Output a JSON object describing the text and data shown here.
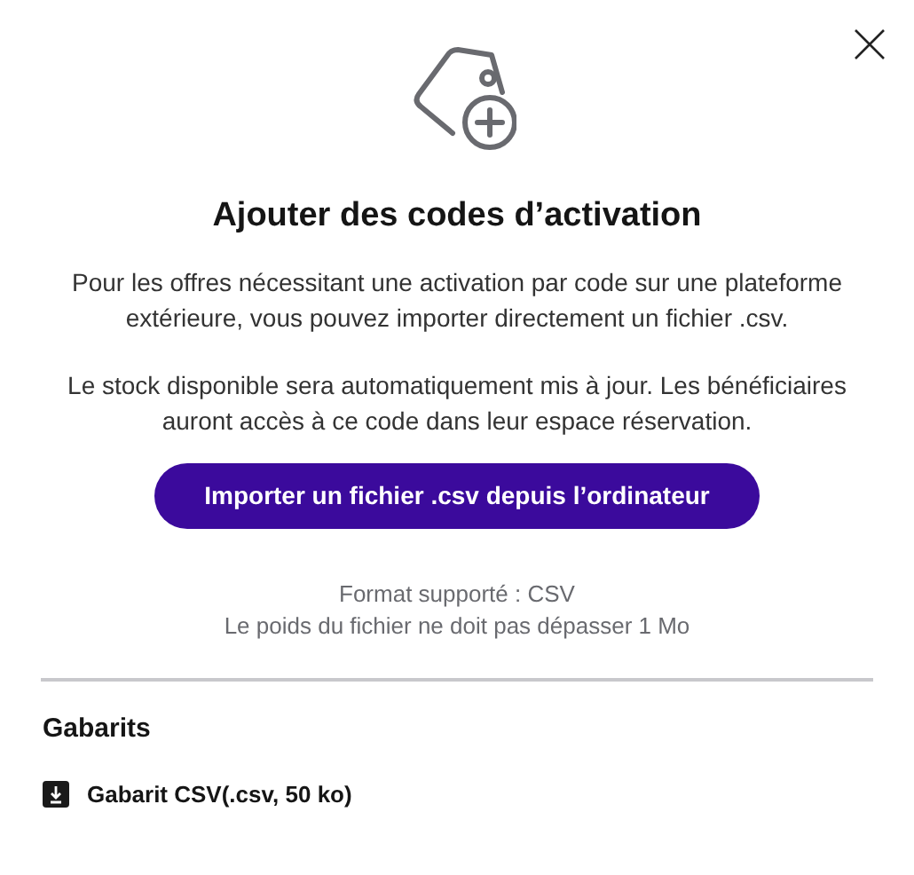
{
  "title": "Ajouter des codes d’activation",
  "paragraphs": [
    "Pour les offres nécessitant une activation par code sur une plateforme extérieure, vous pouvez importer directement un fichier .csv.",
    "Le stock disponible sera automatiquement mis à jour. Les bénéficiaires auront accès à ce code dans leur espace réservation."
  ],
  "import_button": "Importer un fichier .csv depuis l’ordinateur",
  "format_notes": [
    "Format supporté : CSV",
    "Le poids du fichier ne doit pas dépasser 1 Mo"
  ],
  "templates": {
    "heading": "Gabarits",
    "items": [
      {
        "label": "Gabarit CSV(.csv, 50 ko)"
      }
    ]
  }
}
